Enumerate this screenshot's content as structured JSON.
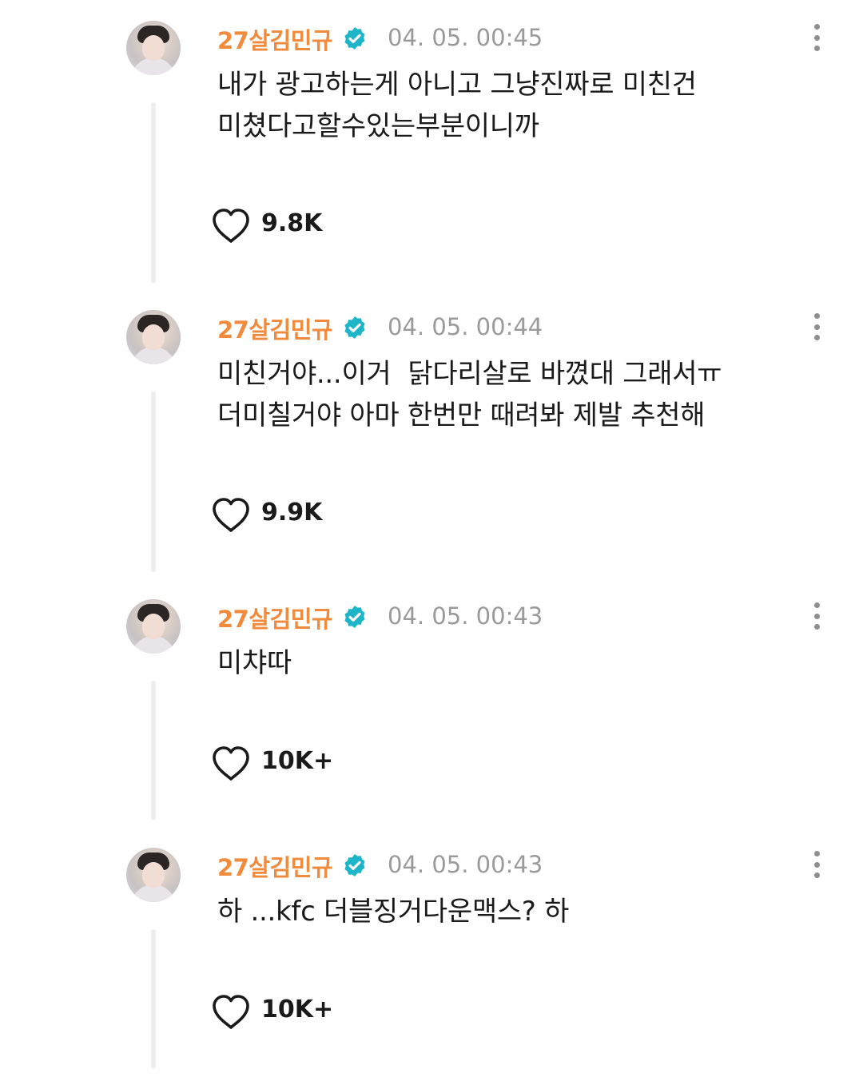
{
  "posts": [
    {
      "username": "27살김민규",
      "timestamp": "04. 05. 00:45",
      "content": "내가 광고하는게 아니고 그냥진짜로 미친건\n미쳤다고할수있는부분이니까",
      "likes": "9.8K"
    },
    {
      "username": "27살김민규",
      "timestamp": "04. 05. 00:44",
      "content": "미친거야...이거  닭다리살로 바꼈대 그래서ㅠ\n더미칠거야 아마 한번만 때려봐 제발 추천해",
      "likes": "9.9K"
    },
    {
      "username": "27살김민규",
      "timestamp": "04. 05. 00:43",
      "content": "미챠따",
      "likes": "10K+"
    },
    {
      "username": "27살김민규",
      "timestamp": "04. 05. 00:43",
      "content": "하 ...kfc 더블징거다운맥스? 하",
      "likes": "10K+"
    }
  ],
  "colors": {
    "username": "#f08a3c",
    "verified_badge": "#1fb5c9",
    "timestamp": "#9a9a9a",
    "thread_line": "#eeeeee"
  },
  "icons": {
    "verified": "verified-badge-icon",
    "more": "more-vertical-icon",
    "like": "heart-outline-icon"
  }
}
